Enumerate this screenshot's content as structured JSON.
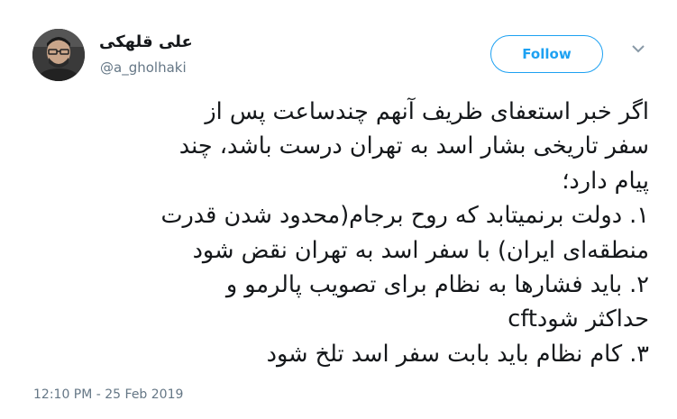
{
  "author": {
    "display_name": "علی قلهکی",
    "handle": "@a_gholhaki",
    "avatar_icon": "user-avatar-photo"
  },
  "actions": {
    "follow_label": "Follow",
    "menu_icon": "chevron-down-icon"
  },
  "tweet": {
    "lines": [
      "اگر خبر استعفای ظریف آنهم چندساعت پس از",
      "سفر تاریخی بشار اسد به تهران درست باشد، چند",
      "پیام دارد؛",
      "۱. دولت برنمیتابد که روح برجام(محدود شدن قدرت",
      "منطقه‌ای ایران) با سفر اسد به تهران نقض شود",
      "۲. باید فشارها به نظام برای تصویب پالرمو و",
      "cftحداکثر شود",
      "۳. کام نظام باید بابت سفر اسد تلخ شود"
    ]
  },
  "meta": {
    "timestamp": "12:10 PM - 25 Feb 2019"
  },
  "colors": {
    "accent": "#1da1f2",
    "text": "#14171a",
    "secondary": "#657786"
  }
}
